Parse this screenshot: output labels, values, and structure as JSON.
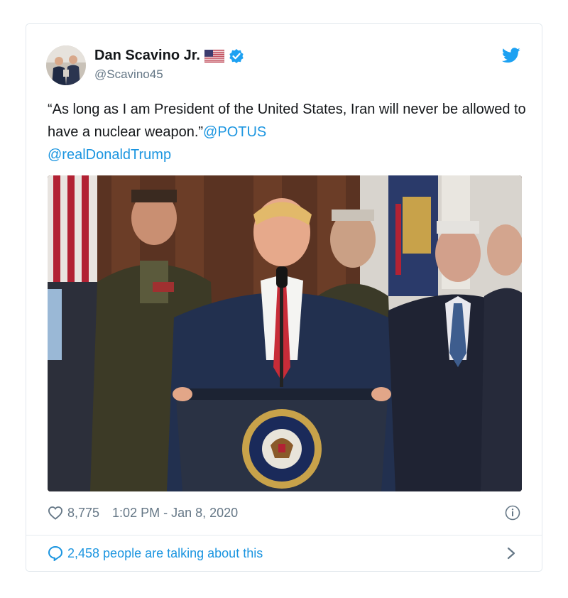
{
  "tweet": {
    "display_name": "Dan Scavino Jr.",
    "handle": "@Scavino45",
    "text_main": "“As long as I am President of the United States, Iran will never be allowed to have a nuclear weapon.”",
    "mention_1": "@POTUS",
    "mention_2": "@realDonaldTrump",
    "likes": "8,775",
    "timestamp": "1:02 PM - Jan 8, 2020",
    "talking": "2,458 people are talking about this"
  },
  "icons": {
    "flag": "us-flag-icon",
    "verified": "verified-badge-icon",
    "brand": "twitter-bird-icon",
    "like": "heart-icon",
    "info": "info-icon",
    "reply": "speech-bubble-icon",
    "chevron": "chevron-right-icon"
  },
  "colors": {
    "link_blue": "#1b95e0",
    "text": "#14171a",
    "secondary": "#657786",
    "border": "#e1e8ed"
  }
}
